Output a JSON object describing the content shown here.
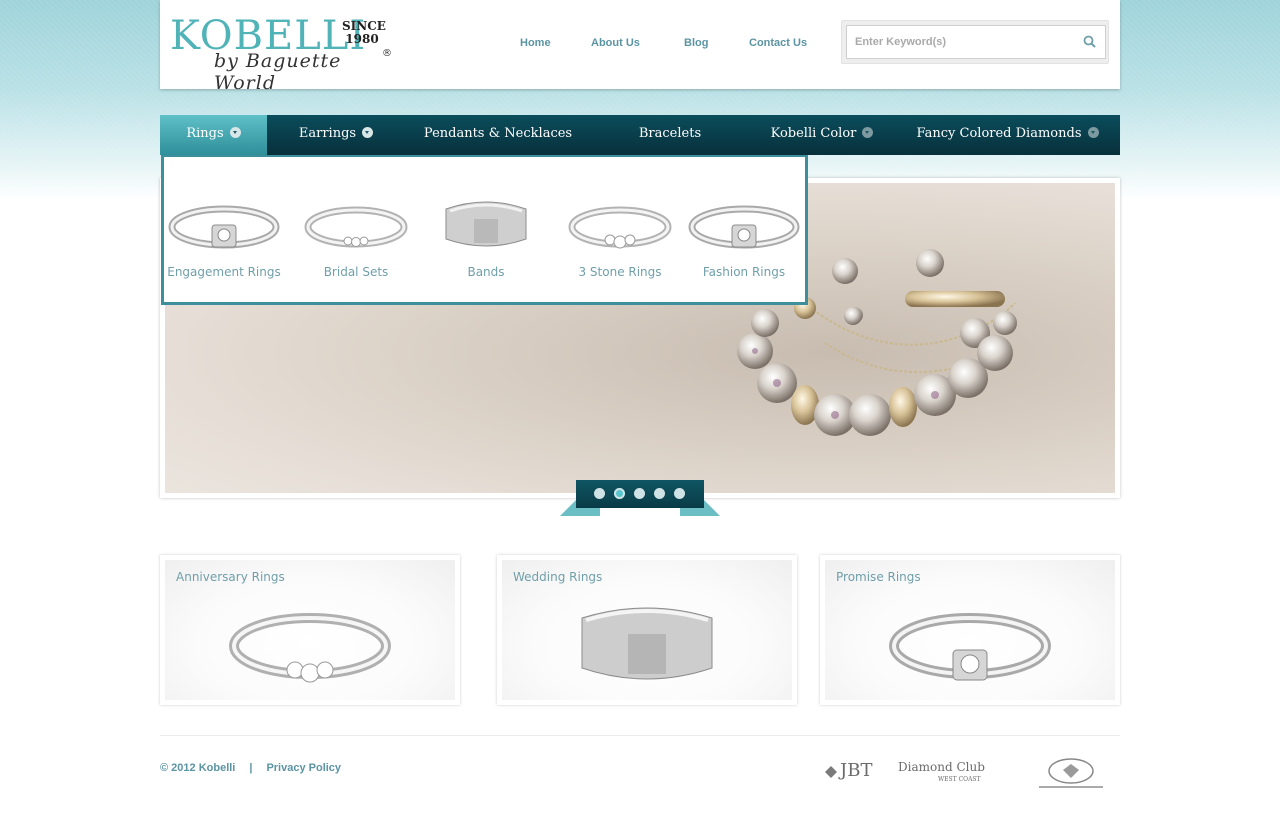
{
  "header": {
    "logo": {
      "name": "KOBELLI",
      "since_line1": "SINCE",
      "since_line2": "1980",
      "byline": "by Baguette World",
      "registered": "®"
    },
    "nav": [
      "Home",
      "About Us",
      "Blog",
      "Contact Us"
    ],
    "search": {
      "placeholder": "Enter Keyword(s)",
      "value": ""
    }
  },
  "main_nav": {
    "items": [
      {
        "label": "Rings",
        "has_dropdown": true,
        "active": true
      },
      {
        "label": "Earrings",
        "has_dropdown": true,
        "active": false
      },
      {
        "label": "Pendants & Necklaces",
        "has_dropdown": false,
        "active": false
      },
      {
        "label": "Bracelets",
        "has_dropdown": false,
        "active": false
      },
      {
        "label": "Kobelli Color",
        "has_dropdown": true,
        "active": false
      },
      {
        "label": "Fancy Colored Diamonds",
        "has_dropdown": true,
        "active": false
      }
    ]
  },
  "rings_dropdown": {
    "items": [
      "Engagement Rings",
      "Bridal Sets",
      "Bands",
      "3 Stone Rings",
      "Fashion Rings"
    ]
  },
  "slider": {
    "slide_count": 5,
    "active_index": 1,
    "image": "charm-bracelet"
  },
  "featured": [
    {
      "title": "Anniversary Rings",
      "image": "three-stone-ring"
    },
    {
      "title": "Wedding Rings",
      "image": "mens-band"
    },
    {
      "title": "Promise Rings",
      "image": "solitaire-pave-ring"
    }
  ],
  "footer": {
    "copyright": "© 2012 Kobelli",
    "separator": "|",
    "privacy": "Privacy Policy",
    "partners": [
      "JBT",
      "Diamond Club",
      "WEST COAST"
    ]
  },
  "colors": {
    "brand_teal": "#4fb3b7",
    "nav_dark": "#0b4d5c",
    "link": "#5b94a3"
  }
}
